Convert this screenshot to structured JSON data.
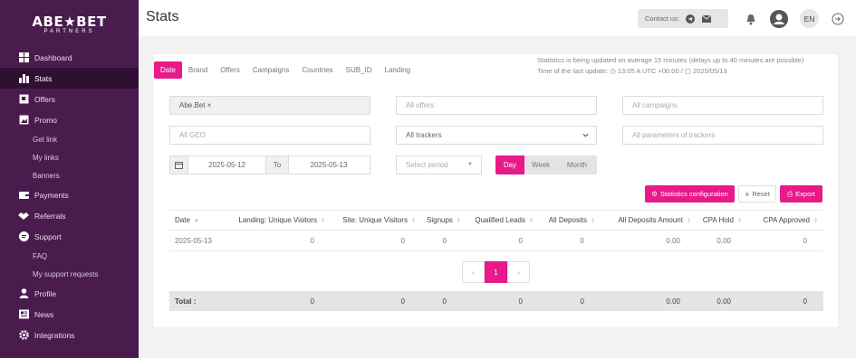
{
  "brand": {
    "logo_main": "ABE★BET",
    "logo_sub": "PARTNERS"
  },
  "sidebar": {
    "items": [
      {
        "label": "Dashboard",
        "icon": "grid-icon"
      },
      {
        "label": "Stats",
        "icon": "bar-chart-icon",
        "active": true
      },
      {
        "label": "Offers",
        "icon": "flag-icon"
      },
      {
        "label": "Promo",
        "icon": "image-icon"
      },
      {
        "label": "Get link",
        "sub": true
      },
      {
        "label": "My links",
        "sub": true
      },
      {
        "label": "Banners",
        "sub": true
      },
      {
        "label": "Payments",
        "icon": "wallet-icon"
      },
      {
        "label": "Referrals",
        "icon": "handshake-icon"
      },
      {
        "label": "Support",
        "icon": "chat-icon"
      },
      {
        "label": "FAQ",
        "sub": true
      },
      {
        "label": "My support requests",
        "sub": true
      },
      {
        "label": "Profile",
        "icon": "user-icon"
      },
      {
        "label": "News",
        "icon": "news-icon"
      },
      {
        "label": "Integrations",
        "icon": "gear-icon"
      }
    ]
  },
  "header": {
    "title": "Stats",
    "contact_label": "Contact us:",
    "lang": "EN"
  },
  "tabs": [
    "Date",
    "Brand",
    "Offers",
    "Campaigns",
    "Countries",
    "SUB_ID",
    "Landing"
  ],
  "status": {
    "line1": "Statistics is being updated on average 15 minutes (delays up to 40 minutes are possible)",
    "prefix": "Time of the last update:",
    "time": "13:05",
    "tz": "UTC +00:00 /",
    "date": "2025/05/13"
  },
  "filters": {
    "brand_tag": "Abe.Bet ×",
    "offers_placeholder": "All offers",
    "campaigns_placeholder": "All campaigns",
    "geo_placeholder": "All GEO",
    "trackers_value": "All trackers",
    "params_placeholder": "All parameters of trackers",
    "date_from": "2025-05-12",
    "date_to_label": "To",
    "date_to": "2025-05-13",
    "period_placeholder": "Select period",
    "period_options": [
      "Day",
      "Week",
      "Month"
    ]
  },
  "buttons": {
    "config": "Statistics configuration",
    "reset": "Reset",
    "export": "Export"
  },
  "table": {
    "columns": [
      "Date",
      "Landing: Unique Visitors",
      "Site: Unique Visitors",
      "Signups",
      "Qualified Leads",
      "All Deposits",
      "All Deposits Amount",
      "CPA Hold",
      "CPA Approved"
    ],
    "rows": [
      [
        "2025-05-13",
        "0",
        "0",
        "0",
        "0",
        "0",
        "0.00",
        "0.00",
        "0"
      ]
    ],
    "total": [
      "Total :",
      "0",
      "0",
      "0",
      "0",
      "0",
      "0.00",
      "0.00",
      "0"
    ]
  },
  "pagination": {
    "prev": "‹",
    "current": "1",
    "next": "›"
  },
  "colors": {
    "accent": "#e8198b",
    "sidebar": "#4a1c4e"
  }
}
